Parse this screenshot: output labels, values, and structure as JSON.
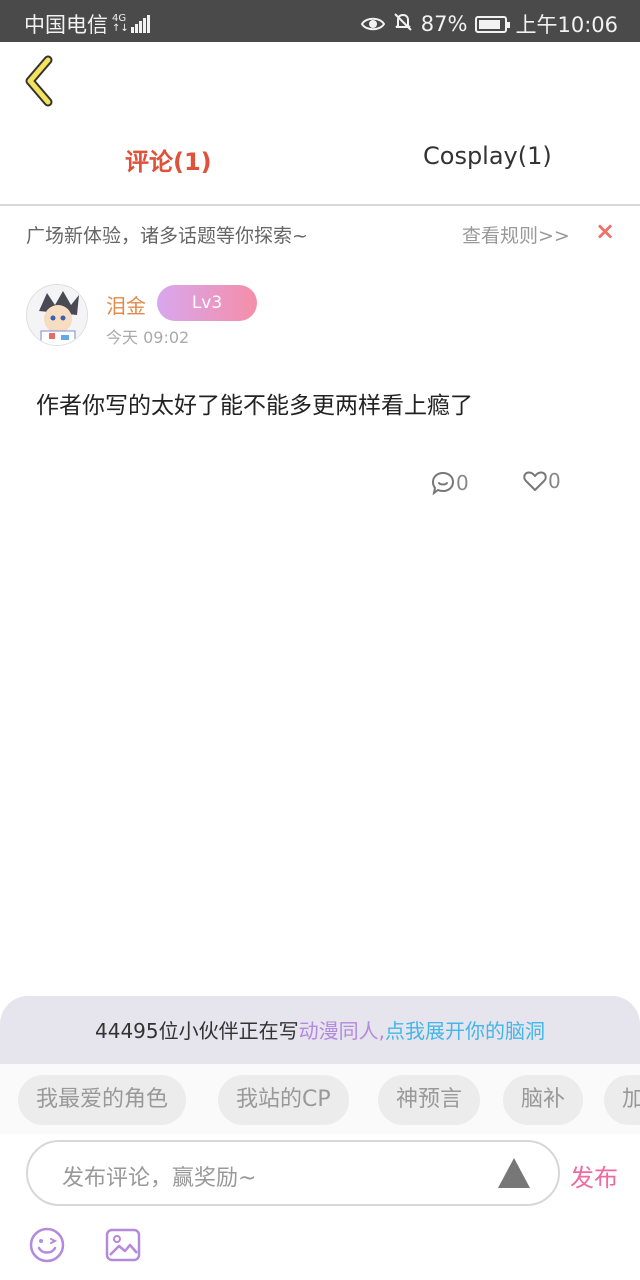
{
  "status_bar": {
    "carrier": "中国电信",
    "network_top": "4G",
    "network_bottom": "↑↓",
    "battery_text": "87%",
    "battery_level": 0.87,
    "time": "上午10:06"
  },
  "header": {
    "back_icon": "chevron-left-icon",
    "tabs": [
      {
        "label": "评论(1)",
        "active": true
      },
      {
        "label": "Cosplay(1)",
        "active": false
      }
    ]
  },
  "notice": {
    "text": "广场新体验，诸多话题等你探索~",
    "link": "查看规则>>",
    "close": "×"
  },
  "comment": {
    "username": "泪金",
    "level": "Lv3",
    "time": "今天 09:02",
    "text": "作者你写的太好了能不能多更两样看上瘾了",
    "reply_count": "0",
    "like_count": "0"
  },
  "promo": {
    "count_text": "44495位小伙伴正在写",
    "highlight1": "动漫同人,",
    "highlight2": "点我展开你的脑洞"
  },
  "chips": [
    "我最爱的角色",
    "我站的CP",
    "神预言",
    "脑补",
    "加"
  ],
  "input": {
    "placeholder": "发布评论，赢奖励~",
    "send_label": "发布"
  },
  "colors": {
    "accent_red": "#e0513a",
    "username_orange": "#e08a4b",
    "send_pink": "#ef6aa2",
    "promo_purple": "#b489de",
    "promo_blue": "#43b7ea"
  }
}
